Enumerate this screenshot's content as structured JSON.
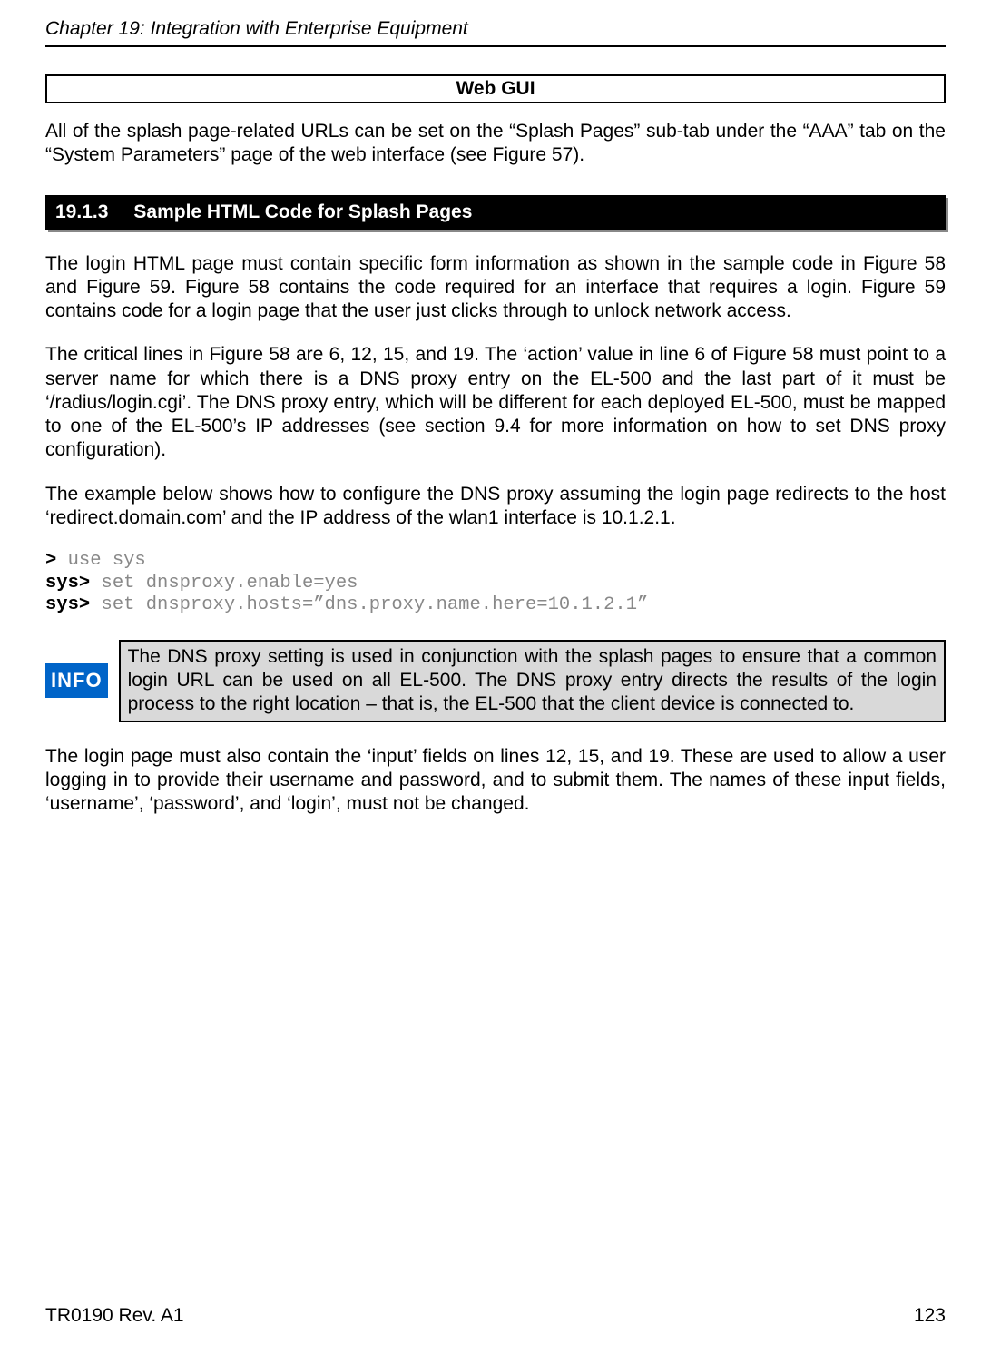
{
  "chapter_header": "Chapter 19: Integration with Enterprise Equipment",
  "web_gui": {
    "title": "Web GUI",
    "text": "All of the splash page-related URLs can be set on the “Splash Pages” sub-tab under the “AAA” tab on the “System Parameters” page of the web interface (see Figure 57)."
  },
  "section": {
    "number": "19.1.3",
    "title": "Sample HTML Code for Splash Pages"
  },
  "para1": "The login HTML page must contain specific form information as shown in the sample code in Figure 58 and Figure 59. Figure 58 contains the code required for an interface that requires a login. Figure 59 contains code for a login page that the user just clicks through to unlock network access.",
  "para2": "The critical lines in Figure 58 are 6, 12, 15, and 19. The ‘action’ value in line 6 of Figure 58 must point to a server name for which there is a DNS proxy entry on the EL-500 and the last part of it must be ‘/radius/login.cgi’. The DNS proxy entry, which will be different for each deployed EL-500, must be mapped to one of the EL-500’s IP addresses (see section 9.4 for more information on how to set DNS proxy configuration).",
  "para3": "The example below shows how to configure the DNS proxy assuming the login page redirects to the host ‘redirect.domain.com’ and the IP address of the wlan1 interface is 10.1.2.1.",
  "cli": {
    "prompt1": ">",
    "cmd1": " use sys",
    "prompt2": "sys>",
    "cmd2": " set dnsproxy.enable=yes",
    "prompt3": "sys>",
    "cmd3": " set dnsproxy.hosts=”dns.proxy.name.here=10.1.2.1”"
  },
  "info": {
    "badge": "INFO",
    "text": "The DNS proxy setting is used in conjunction with the splash pages to ensure that a common login URL can be used on all EL-500. The DNS proxy entry directs the results of the login process to the right location – that is, the EL-500 that the client device is connected to."
  },
  "para4": "The login page must also contain the ‘input’ fields on lines 12, 15, and 19. These are used to allow a user logging in to provide their username and password, and to submit them. The names of these input fields, ‘username’, ‘password’, and ‘login’, must not be changed.",
  "footer": {
    "left": "TR0190 Rev. A1",
    "right": "123"
  }
}
